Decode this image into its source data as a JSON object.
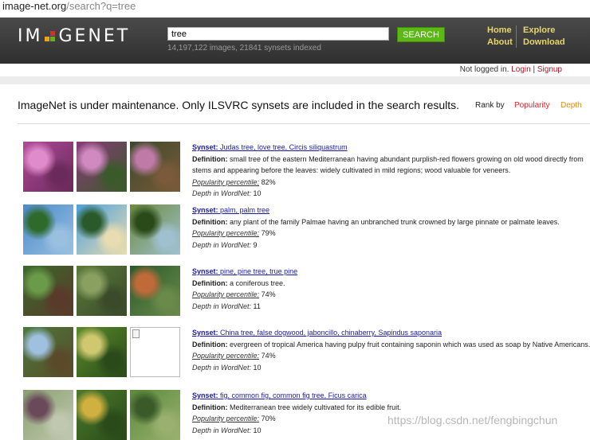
{
  "address_bar": {
    "host": "image-net.org",
    "path": "/search?q=tree"
  },
  "header": {
    "logo_left": "IM",
    "logo_right": "GENET",
    "search_value": "tree",
    "search_button": "SEARCH",
    "stats": "14,197,122 images, 21841 synsets indexed",
    "nav": {
      "home": "Home",
      "about": "About",
      "explore": "Explore",
      "download": "Download"
    }
  },
  "login": {
    "status": "Not logged in.",
    "login": "Login",
    "separator": "|",
    "signup": "Signup"
  },
  "notice": "ImageNet is under maintenance. Only ILSVRC synsets are included in the search results.",
  "rank": {
    "label": "Rank by",
    "popularity": "Popularity",
    "depth": "Depth"
  },
  "labels": {
    "synset": "Synset:",
    "definition": "Definition:",
    "popularity": "Popularity percentile:",
    "depth": "Depth in WordNet:"
  },
  "results": [
    {
      "synset": "Judas tree, love tree, Circis siliquastrum",
      "definition": "small tree of the eastern Mediterranean having abundant purplish-red flowers growing on old wood directly from stems and appearing before the leaves: widely cultivated in mild regions; wood valuable for veneers.",
      "popularity": "82%",
      "depth": "10",
      "thumb_colors": [
        [
          "#b04a9a",
          "#e08ccc",
          "#6a2a5a"
        ],
        [
          "#8a3a7a",
          "#d08ac0",
          "#3a5a2a"
        ],
        [
          "#3a4a2a",
          "#c07aa8",
          "#7a5a3a"
        ]
      ]
    },
    {
      "synset": "palm, palm tree",
      "definition": "any plant of the family Palmae having an unbranched trunk crowned by large pinnate or palmate leaves.",
      "popularity": "79%",
      "depth": "9",
      "thumb_colors": [
        [
          "#4a8acc",
          "#2e6a2a",
          "#9ac0e0"
        ],
        [
          "#4aa0e0",
          "#2a5a2a",
          "#e8dcb0"
        ],
        [
          "#6a8a3a",
          "#2a4a1a",
          "#a0c0d0"
        ]
      ]
    },
    {
      "synset": "pine, pine tree, true pine",
      "definition": "a coniferous tree.",
      "popularity": "74%",
      "depth": "11",
      "thumb_colors": [
        [
          "#3a6a2a",
          "#6a9a4a",
          "#5a3a2a"
        ],
        [
          "#5a7a3a",
          "#8aa060",
          "#3a4a2a"
        ],
        [
          "#2a5a2a",
          "#c06a3a",
          "#6a8a4a"
        ]
      ]
    },
    {
      "synset": "China tree, false dogwood, jaboncillo, chinaberry, Sapindus saponaria",
      "definition": "evergreen of tropical America having pulpy fruit containing saponin which was used as soap by Native Americans.",
      "popularity": "74%",
      "depth": "10",
      "thumb_colors": [
        [
          "#4a7a3a",
          "#a0c0e0",
          "#5a4a2a"
        ],
        [
          "#5a8a2a",
          "#d0c870",
          "#2a4a1a"
        ],
        null
      ]
    },
    {
      "synset": "fig, common fig, common fig tree, Ficus carica",
      "definition": "Mediterranean tree widely cultivated for its edible fruit.",
      "popularity": "70%",
      "depth": "10",
      "thumb_colors": [
        [
          "#8aa070",
          "#6a4a5a",
          "#c0c8b0"
        ],
        [
          "#4a7a2a",
          "#d0b040",
          "#2a4a1a"
        ],
        [
          "#5a8a3a",
          "#3a5a2a",
          "#9ab070"
        ]
      ]
    }
  ],
  "watermark": "https://blog.csdn.net/fengbingchun"
}
